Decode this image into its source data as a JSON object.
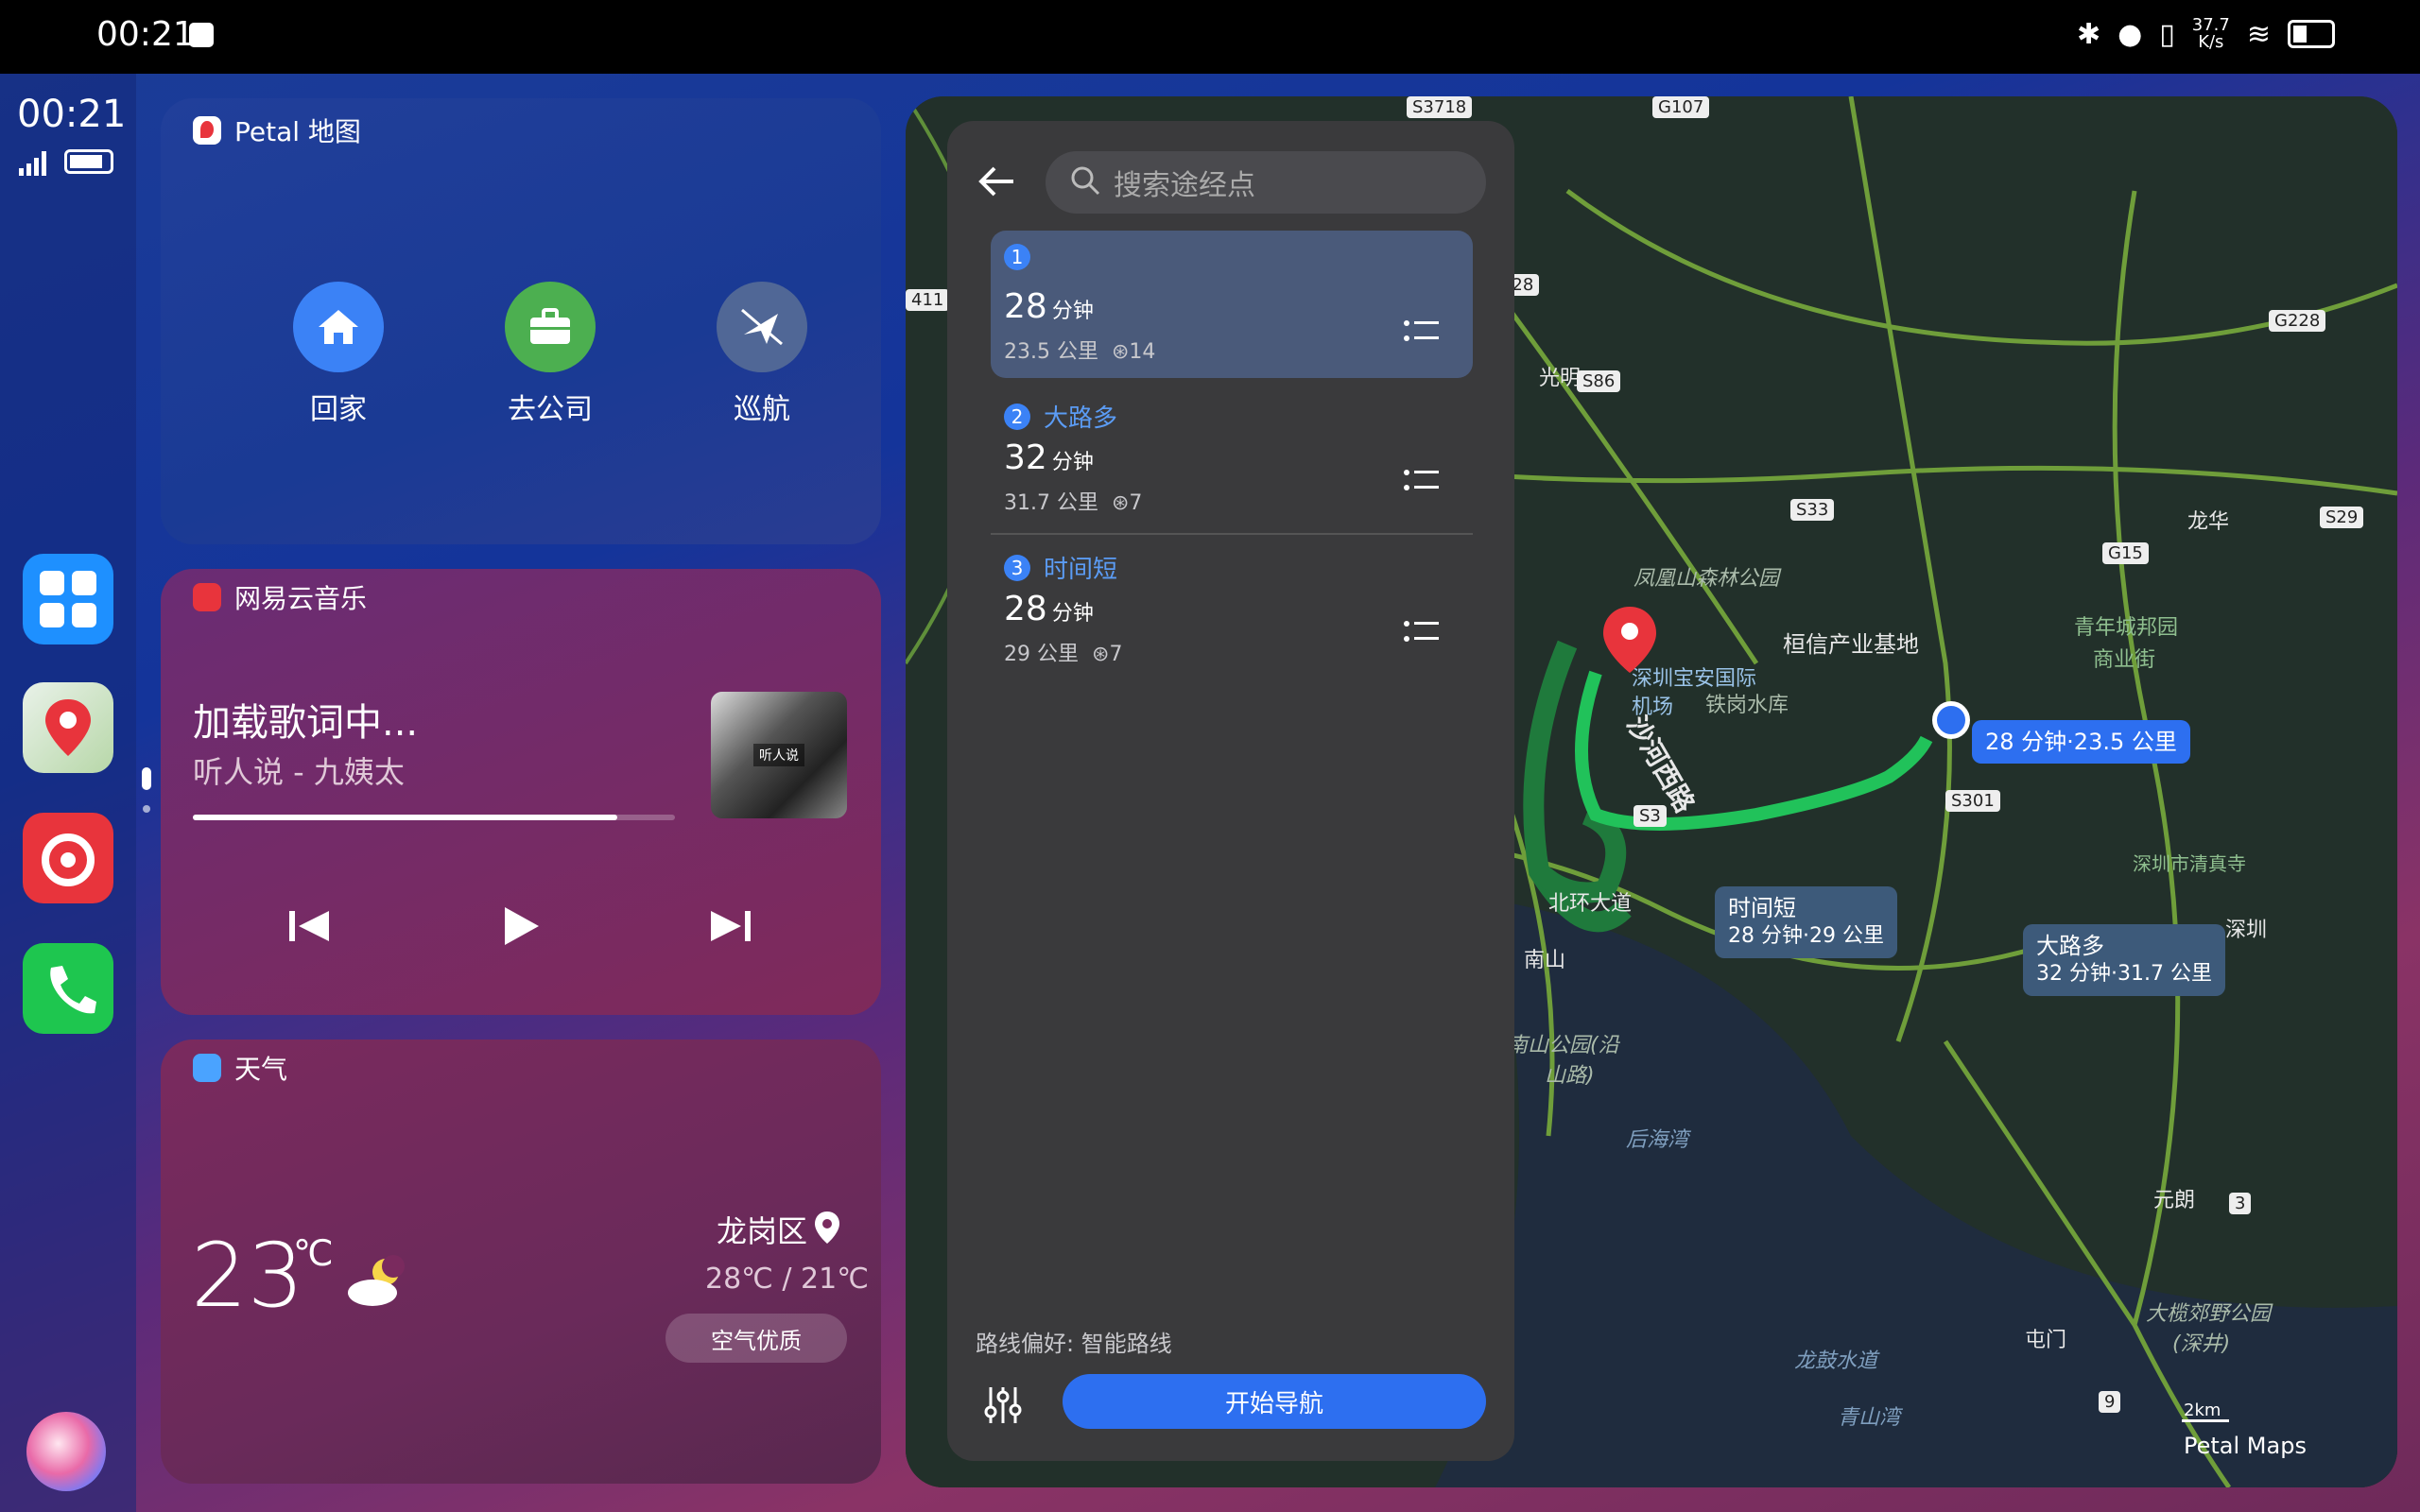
{
  "status_bar": {
    "time": "00:21",
    "net_speed_top": "37.7",
    "net_speed_bottom": "K/s"
  },
  "dock": {
    "time": "00:21"
  },
  "map_widget": {
    "title": "Petal 地图",
    "actions": [
      {
        "label": "回家"
      },
      {
        "label": "去公司"
      },
      {
        "label": "巡航"
      }
    ]
  },
  "music_widget": {
    "title": "网易云音乐",
    "lyrics": "加载歌词中...",
    "song": "听人说 - 九姨太",
    "album_text": "听人说",
    "progress": 0.88
  },
  "weather_widget": {
    "title": "天气",
    "temp": "23",
    "unit": "℃",
    "location": "龙岗区",
    "range": "28℃ / 21℃",
    "air": "空气优质"
  },
  "nav": {
    "search_placeholder": "搜索途经点",
    "routes": [
      {
        "num": "1",
        "tag": "",
        "time": "28",
        "unit": "分钟",
        "distance": "23.5 公里",
        "lights": "14"
      },
      {
        "num": "2",
        "tag": "大路多",
        "time": "32",
        "unit": "分钟",
        "distance": "31.7 公里",
        "lights": "7"
      },
      {
        "num": "3",
        "tag": "时间短",
        "time": "28",
        "unit": "分钟",
        "distance": "29 公里",
        "lights": "7"
      }
    ],
    "pref_label": "路线偏好:",
    "pref_value": "智能路线",
    "start_button": "开始导航"
  },
  "map": {
    "places": [
      "光明",
      "龙华",
      "凤凰山森林公园",
      "桓信产业基地",
      "青年城邦园",
      "商业街",
      "深圳宝安国际",
      "机场",
      "铁岗水库",
      "北环大道",
      "深圳市清真寺",
      "深圳",
      "南山",
      "南山公园(沿",
      "山路)",
      "后海湾",
      "元朗",
      "大榄郊野公园",
      "(深井)",
      "屯门",
      "龙鼓水道",
      "青山湾",
      "沙河西路"
    ],
    "road_tags": [
      "G107",
      "S3718",
      "G228",
      "G228",
      "S86",
      "S33",
      "G15",
      "S29",
      "S3",
      "S301",
      "411",
      "3",
      "9"
    ],
    "bubbles": {
      "main": "28 分钟·23.5 公里",
      "short_title": "时间短",
      "short_meta": "28 分钟·29 公里",
      "highway_title": "大路多",
      "highway_meta": "32 分钟·31.7 公里"
    },
    "scale": "2km",
    "brand": "Petal Maps"
  }
}
